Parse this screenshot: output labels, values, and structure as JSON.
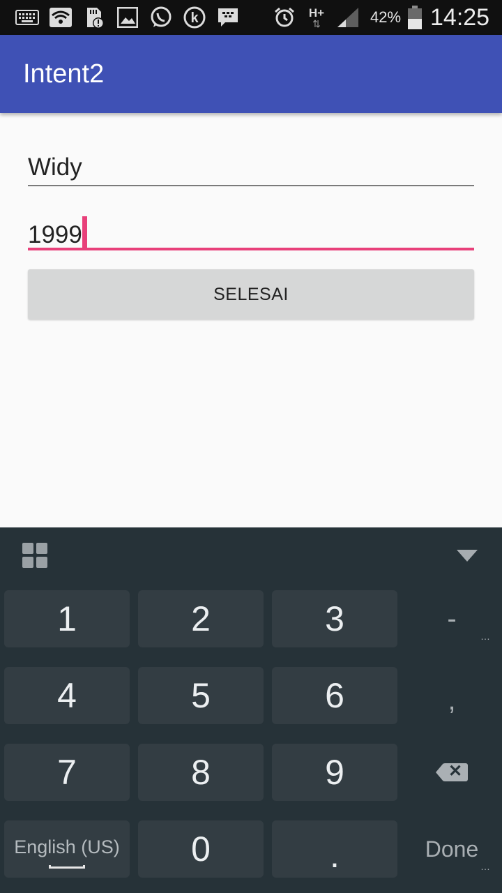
{
  "status_bar": {
    "icons_left": [
      "keyboard-icon",
      "wifi-icon",
      "sd-card-alert-icon",
      "gallery-icon",
      "whatsapp-icon",
      "kakao-icon",
      "bbm-icon"
    ],
    "icons_right": [
      "alarm-icon",
      "network-hplus-icon",
      "signal-icon",
      "battery-icon"
    ],
    "network_type": "H+",
    "battery_percent": "42%",
    "time": "14:25"
  },
  "app_bar": {
    "title": "Intent2",
    "color": "#3f51b5"
  },
  "form": {
    "name_value": "Widy",
    "year_value": "1999",
    "active_color": "#e8407a",
    "submit_label": "SELESAI"
  },
  "keyboard": {
    "keys": {
      "k1": "1",
      "k2": "2",
      "k3": "3",
      "minus": "-",
      "k4": "4",
      "k5": "5",
      "k6": "6",
      "comma": ",",
      "k7": "7",
      "k8": "8",
      "k9": "9",
      "language": "English (US)",
      "k0": "0",
      "period": ".",
      "done": "Done"
    }
  }
}
